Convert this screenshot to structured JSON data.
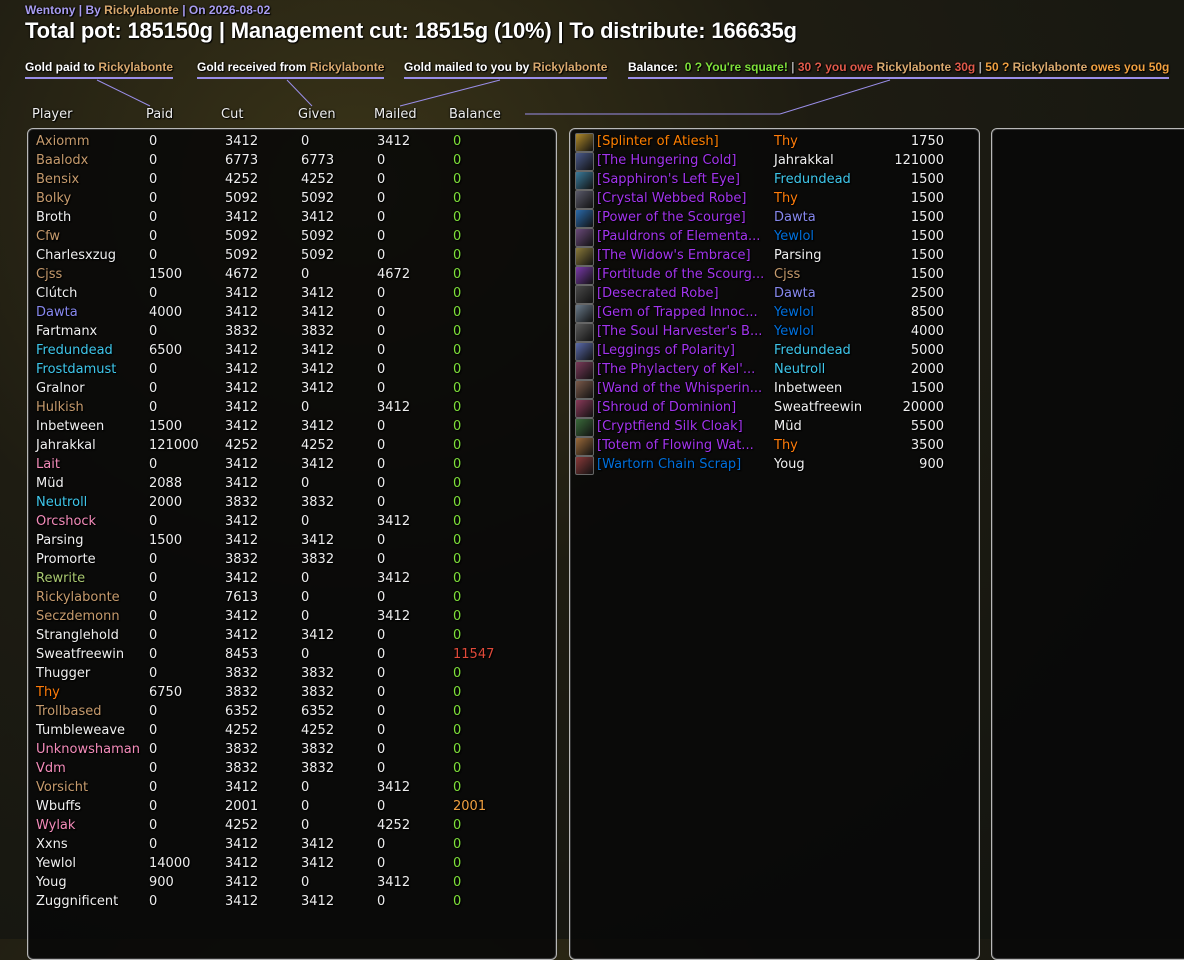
{
  "header": {
    "by_prefix": "Wentony | By ",
    "author": "Rickylabonte",
    "on_prefix": " | On ",
    "date": "2026-08-02",
    "pot_line": "Total pot: 185150g | Management cut: 18515g (10%) | To distribute: 166635g"
  },
  "legend": {
    "paid_text": "Gold paid to ",
    "paid_name": "Rickylabonte",
    "given_text": "Gold received from ",
    "given_name": "Rickylabonte",
    "mailed_text": "Gold mailed to you by ",
    "mailed_name": "Rickylabonte",
    "balance_label": "Balance:",
    "bal_zero": "0 ? You're square!",
    "sep1": " | ",
    "bal_owe_a": "30 ? you owe ",
    "bal_owe_name": "Rickylabonte",
    "bal_owe_b": " 30g",
    "sep2": " | ",
    "bal_owed_a": "50 ? ",
    "bal_owed_name": "Rickylabonte",
    "bal_owed_b": " owes you 50g"
  },
  "columns": {
    "player": "Player",
    "paid": "Paid",
    "cut": "Cut",
    "given": "Given",
    "mailed": "Mailed",
    "balance": "Balance"
  },
  "colors": {
    "hunter": "#a9c870",
    "warrior": "#c69b6d",
    "mage": "#3fc7eb",
    "warlock": "#8788ee",
    "priest": "#f0f0f0",
    "rogue": "#fff468",
    "druid": "#ff7c0a",
    "paladin": "#f48cba",
    "shaman": "#0070dd",
    "epic": "#a335ee",
    "balance_zero": "#7fe03a",
    "balance_neg": "#e04a3a",
    "balance_pos": "#f0a040"
  },
  "players": [
    {
      "name": "Axiomm",
      "cls": "warrior",
      "paid": "0",
      "cut": "3412",
      "given": "0",
      "mailed": "3412",
      "balance": "0",
      "bal": "zero"
    },
    {
      "name": "Baalodx",
      "cls": "warrior",
      "paid": "0",
      "cut": "6773",
      "given": "6773",
      "mailed": "0",
      "balance": "0",
      "bal": "zero"
    },
    {
      "name": "Bensix",
      "cls": "warrior",
      "paid": "0",
      "cut": "4252",
      "given": "4252",
      "mailed": "0",
      "balance": "0",
      "bal": "zero"
    },
    {
      "name": "Bolky",
      "cls": "warrior",
      "paid": "0",
      "cut": "5092",
      "given": "5092",
      "mailed": "0",
      "balance": "0",
      "bal": "zero"
    },
    {
      "name": "Broth",
      "cls": "priest",
      "paid": "0",
      "cut": "3412",
      "given": "3412",
      "mailed": "0",
      "balance": "0",
      "bal": "zero"
    },
    {
      "name": "Cfw",
      "cls": "warrior",
      "paid": "0",
      "cut": "5092",
      "given": "5092",
      "mailed": "0",
      "balance": "0",
      "bal": "zero"
    },
    {
      "name": "Charlesxzug",
      "cls": "priest",
      "paid": "0",
      "cut": "5092",
      "given": "5092",
      "mailed": "0",
      "balance": "0",
      "bal": "zero"
    },
    {
      "name": "Cjss",
      "cls": "warrior",
      "paid": "1500",
      "cut": "4672",
      "given": "0",
      "mailed": "4672",
      "balance": "0",
      "bal": "zero"
    },
    {
      "name": "Clútch",
      "cls": "priest",
      "paid": "0",
      "cut": "3412",
      "given": "3412",
      "mailed": "0",
      "balance": "0",
      "bal": "zero"
    },
    {
      "name": "Dawta",
      "cls": "warlock",
      "paid": "4000",
      "cut": "3412",
      "given": "3412",
      "mailed": "0",
      "balance": "0",
      "bal": "zero"
    },
    {
      "name": "Fartmanx",
      "cls": "priest",
      "paid": "0",
      "cut": "3832",
      "given": "3832",
      "mailed": "0",
      "balance": "0",
      "bal": "zero"
    },
    {
      "name": "Fredundead",
      "cls": "mage",
      "paid": "6500",
      "cut": "3412",
      "given": "3412",
      "mailed": "0",
      "balance": "0",
      "bal": "zero"
    },
    {
      "name": "Frostdamust",
      "cls": "mage",
      "paid": "0",
      "cut": "3412",
      "given": "3412",
      "mailed": "0",
      "balance": "0",
      "bal": "zero"
    },
    {
      "name": "Gralnor",
      "cls": "priest",
      "paid": "0",
      "cut": "3412",
      "given": "3412",
      "mailed": "0",
      "balance": "0",
      "bal": "zero"
    },
    {
      "name": "Hulkish",
      "cls": "warrior",
      "paid": "0",
      "cut": "3412",
      "given": "0",
      "mailed": "3412",
      "balance": "0",
      "bal": "zero"
    },
    {
      "name": "Inbetween",
      "cls": "priest",
      "paid": "1500",
      "cut": "3412",
      "given": "3412",
      "mailed": "0",
      "balance": "0",
      "bal": "zero"
    },
    {
      "name": "Jahrakkal",
      "cls": "priest",
      "paid": "121000",
      "cut": "4252",
      "given": "4252",
      "mailed": "0",
      "balance": "0",
      "bal": "zero"
    },
    {
      "name": "Lait",
      "cls": "paladin",
      "paid": "0",
      "cut": "3412",
      "given": "3412",
      "mailed": "0",
      "balance": "0",
      "bal": "zero"
    },
    {
      "name": "Müd",
      "cls": "priest",
      "paid": "2088",
      "cut": "3412",
      "given": "0",
      "mailed": "0",
      "balance": "0",
      "bal": "zero"
    },
    {
      "name": "Neutroll",
      "cls": "mage",
      "paid": "2000",
      "cut": "3832",
      "given": "3832",
      "mailed": "0",
      "balance": "0",
      "bal": "zero"
    },
    {
      "name": "Orcshock",
      "cls": "paladin",
      "paid": "0",
      "cut": "3412",
      "given": "0",
      "mailed": "3412",
      "balance": "0",
      "bal": "zero"
    },
    {
      "name": "Parsing",
      "cls": "priest",
      "paid": "1500",
      "cut": "3412",
      "given": "3412",
      "mailed": "0",
      "balance": "0",
      "bal": "zero"
    },
    {
      "name": "Promorte",
      "cls": "priest",
      "paid": "0",
      "cut": "3832",
      "given": "3832",
      "mailed": "0",
      "balance": "0",
      "bal": "zero"
    },
    {
      "name": "Rewrite",
      "cls": "hunter",
      "paid": "0",
      "cut": "3412",
      "given": "0",
      "mailed": "3412",
      "balance": "0",
      "bal": "zero"
    },
    {
      "name": "Rickylabonte",
      "cls": "warrior",
      "paid": "0",
      "cut": "7613",
      "given": "0",
      "mailed": "0",
      "balance": "0",
      "bal": "zero"
    },
    {
      "name": "Seczdemonn",
      "cls": "warrior",
      "paid": "0",
      "cut": "3412",
      "given": "0",
      "mailed": "3412",
      "balance": "0",
      "bal": "zero"
    },
    {
      "name": "Stranglehold",
      "cls": "priest",
      "paid": "0",
      "cut": "3412",
      "given": "3412",
      "mailed": "0",
      "balance": "0",
      "bal": "zero"
    },
    {
      "name": "Sweatfreewin",
      "cls": "priest",
      "paid": "0",
      "cut": "8453",
      "given": "0",
      "mailed": "0",
      "balance": "11547",
      "bal": "neg"
    },
    {
      "name": "Thugger",
      "cls": "priest",
      "paid": "0",
      "cut": "3832",
      "given": "3832",
      "mailed": "0",
      "balance": "0",
      "bal": "zero"
    },
    {
      "name": "Thy",
      "cls": "druid",
      "paid": "6750",
      "cut": "3832",
      "given": "3832",
      "mailed": "0",
      "balance": "0",
      "bal": "zero"
    },
    {
      "name": "Trollbased",
      "cls": "warrior",
      "paid": "0",
      "cut": "6352",
      "given": "6352",
      "mailed": "0",
      "balance": "0",
      "bal": "zero"
    },
    {
      "name": "Tumbleweave",
      "cls": "priest",
      "paid": "0",
      "cut": "4252",
      "given": "4252",
      "mailed": "0",
      "balance": "0",
      "bal": "zero"
    },
    {
      "name": "Unknowshaman",
      "cls": "paladin",
      "paid": "0",
      "cut": "3832",
      "given": "3832",
      "mailed": "0",
      "balance": "0",
      "bal": "zero"
    },
    {
      "name": "Vdm",
      "cls": "paladin",
      "paid": "0",
      "cut": "3832",
      "given": "3832",
      "mailed": "0",
      "balance": "0",
      "bal": "zero"
    },
    {
      "name": "Vorsicht",
      "cls": "warrior",
      "paid": "0",
      "cut": "3412",
      "given": "0",
      "mailed": "3412",
      "balance": "0",
      "bal": "zero"
    },
    {
      "name": "Wbuffs",
      "cls": "priest",
      "paid": "0",
      "cut": "2001",
      "given": "0",
      "mailed": "0",
      "balance": "2001",
      "bal": "pos"
    },
    {
      "name": "Wylak",
      "cls": "paladin",
      "paid": "0",
      "cut": "4252",
      "given": "0",
      "mailed": "4252",
      "balance": "0",
      "bal": "zero"
    },
    {
      "name": "Xxns",
      "cls": "priest",
      "paid": "0",
      "cut": "3412",
      "given": "3412",
      "mailed": "0",
      "balance": "0",
      "bal": "zero"
    },
    {
      "name": "Yewlol",
      "cls": "priest",
      "paid": "14000",
      "cut": "3412",
      "given": "3412",
      "mailed": "0",
      "balance": "0",
      "bal": "zero"
    },
    {
      "name": "Youg",
      "cls": "priest",
      "paid": "900",
      "cut": "3412",
      "given": "0",
      "mailed": "3412",
      "balance": "0",
      "bal": "zero"
    },
    {
      "name": "Zuggnificent",
      "cls": "priest",
      "paid": "0",
      "cut": "3412",
      "given": "3412",
      "mailed": "0",
      "balance": "0",
      "bal": "zero"
    }
  ],
  "items": [
    {
      "item": "[Splinter of Atiesh]",
      "quality": "legendary",
      "player": "Thy",
      "cls": "druid",
      "price": "1750",
      "icon": "splinter-icon",
      "icolor": "#b08a2a"
    },
    {
      "item": "[The Hungering Cold]",
      "quality": "epic",
      "player": "Jahrakkal",
      "cls": "priest",
      "price": "121000",
      "icon": "sword-icon",
      "icolor": "#4a5a8a"
    },
    {
      "item": "[Sapphiron's Left Eye]",
      "quality": "epic",
      "player": "Fredundead",
      "cls": "mage",
      "price": "1500",
      "icon": "gem-icon",
      "icolor": "#3a7a9a"
    },
    {
      "item": "[Crystal Webbed Robe]",
      "quality": "epic",
      "player": "Thy",
      "cls": "druid",
      "price": "1500",
      "icon": "robe-icon",
      "icolor": "#5a5a6a"
    },
    {
      "item": "[Power of the Scourge]",
      "quality": "epic",
      "player": "Dawta",
      "cls": "warlock",
      "price": "1500",
      "icon": "orb-icon",
      "icolor": "#2a6aaa"
    },
    {
      "item": "[Pauldrons of Elementa...",
      "quality": "epic",
      "player": "Yewlol",
      "cls": "shaman",
      "price": "1500",
      "icon": "shoulder-icon",
      "icolor": "#6a4a7a"
    },
    {
      "item": "[The Widow's Embrace]",
      "quality": "epic",
      "player": "Parsing",
      "cls": "priest",
      "price": "1500",
      "icon": "mace-icon",
      "icolor": "#8a7a3a"
    },
    {
      "item": "[Fortitude of the Scourg...",
      "quality": "epic",
      "player": "Cjss",
      "cls": "warrior",
      "price": "1500",
      "icon": "shield-icon",
      "icolor": "#7a3aaa"
    },
    {
      "item": "[Desecrated Robe]",
      "quality": "epic",
      "player": "Dawta",
      "cls": "warlock",
      "price": "2500",
      "icon": "robe-icon",
      "icolor": "#4a4a4a"
    },
    {
      "item": "[Gem of Trapped Innoc...",
      "quality": "epic",
      "player": "Yewlol",
      "cls": "shaman",
      "price": "8500",
      "icon": "gem-icon",
      "icolor": "#6a7a8a"
    },
    {
      "item": "[The Soul Harvester's B...",
      "quality": "epic",
      "player": "Yewlol",
      "cls": "shaman",
      "price": "4000",
      "icon": "bindings-icon",
      "icolor": "#5a5a5a"
    },
    {
      "item": "[Leggings of Polarity]",
      "quality": "epic",
      "player": "Fredundead",
      "cls": "mage",
      "price": "5000",
      "icon": "leggings-icon",
      "icolor": "#5a6aaa"
    },
    {
      "item": "[The Phylactery of Kel'...",
      "quality": "epic",
      "player": "Neutroll",
      "cls": "mage",
      "price": "2000",
      "icon": "phylactery-icon",
      "icolor": "#7a3a5a"
    },
    {
      "item": "[Wand of the Whisperin...",
      "quality": "epic",
      "player": "Inbetween",
      "cls": "priest",
      "price": "1500",
      "icon": "wand-icon",
      "icolor": "#7a5a4a"
    },
    {
      "item": "[Shroud of Dominion]",
      "quality": "epic",
      "player": "Sweatfreewin",
      "cls": "priest",
      "price": "20000",
      "icon": "shroud-icon",
      "icolor": "#8a3a5a"
    },
    {
      "item": "[Cryptfiend Silk Cloak]",
      "quality": "epic",
      "player": "Müd",
      "cls": "priest",
      "price": "5500",
      "icon": "cloak-icon",
      "icolor": "#3a6a3a"
    },
    {
      "item": "[Totem of Flowing Wat...",
      "quality": "epic",
      "player": "Thy",
      "cls": "druid",
      "price": "3500",
      "icon": "totem-icon",
      "icolor": "#9a6a3a"
    },
    {
      "item": "[Wartorn Chain Scrap]",
      "quality": "shaman",
      "player": "Youg",
      "cls": "priest",
      "price": "900",
      "icon": "scrap-icon",
      "icolor": "#8a3a3a"
    }
  ]
}
